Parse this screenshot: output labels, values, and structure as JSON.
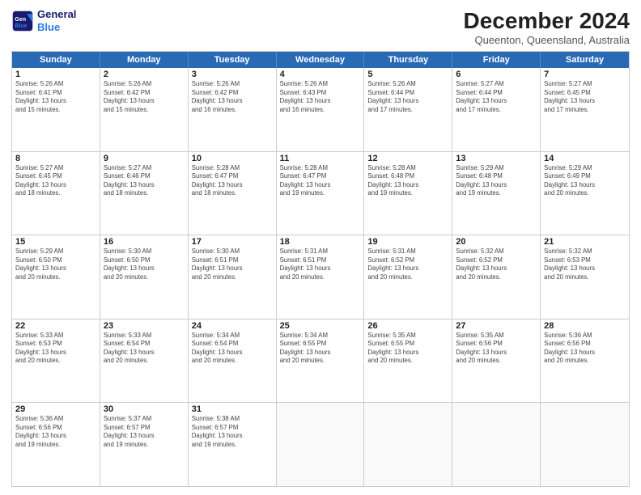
{
  "logo": {
    "line1": "General",
    "line2": "Blue"
  },
  "title": "December 2024",
  "subtitle": "Queenton, Queensland, Australia",
  "days_of_week": [
    "Sunday",
    "Monday",
    "Tuesday",
    "Wednesday",
    "Thursday",
    "Friday",
    "Saturday"
  ],
  "weeks": [
    [
      {
        "day": "1",
        "info": "Sunrise: 5:26 AM\nSunset: 6:41 PM\nDaylight: 13 hours\nand 15 minutes."
      },
      {
        "day": "2",
        "info": "Sunrise: 5:26 AM\nSunset: 6:42 PM\nDaylight: 13 hours\nand 15 minutes."
      },
      {
        "day": "3",
        "info": "Sunrise: 5:26 AM\nSunset: 6:42 PM\nDaylight: 13 hours\nand 16 minutes."
      },
      {
        "day": "4",
        "info": "Sunrise: 5:26 AM\nSunset: 6:43 PM\nDaylight: 13 hours\nand 16 minutes."
      },
      {
        "day": "5",
        "info": "Sunrise: 5:26 AM\nSunset: 6:44 PM\nDaylight: 13 hours\nand 17 minutes."
      },
      {
        "day": "6",
        "info": "Sunrise: 5:27 AM\nSunset: 6:44 PM\nDaylight: 13 hours\nand 17 minutes."
      },
      {
        "day": "7",
        "info": "Sunrise: 5:27 AM\nSunset: 6:45 PM\nDaylight: 13 hours\nand 17 minutes."
      }
    ],
    [
      {
        "day": "8",
        "info": "Sunrise: 5:27 AM\nSunset: 6:45 PM\nDaylight: 13 hours\nand 18 minutes."
      },
      {
        "day": "9",
        "info": "Sunrise: 5:27 AM\nSunset: 6:46 PM\nDaylight: 13 hours\nand 18 minutes."
      },
      {
        "day": "10",
        "info": "Sunrise: 5:28 AM\nSunset: 6:47 PM\nDaylight: 13 hours\nand 18 minutes."
      },
      {
        "day": "11",
        "info": "Sunrise: 5:28 AM\nSunset: 6:47 PM\nDaylight: 13 hours\nand 19 minutes."
      },
      {
        "day": "12",
        "info": "Sunrise: 5:28 AM\nSunset: 6:48 PM\nDaylight: 13 hours\nand 19 minutes."
      },
      {
        "day": "13",
        "info": "Sunrise: 5:29 AM\nSunset: 6:48 PM\nDaylight: 13 hours\nand 19 minutes."
      },
      {
        "day": "14",
        "info": "Sunrise: 5:29 AM\nSunset: 6:49 PM\nDaylight: 13 hours\nand 20 minutes."
      }
    ],
    [
      {
        "day": "15",
        "info": "Sunrise: 5:29 AM\nSunset: 6:50 PM\nDaylight: 13 hours\nand 20 minutes."
      },
      {
        "day": "16",
        "info": "Sunrise: 5:30 AM\nSunset: 6:50 PM\nDaylight: 13 hours\nand 20 minutes."
      },
      {
        "day": "17",
        "info": "Sunrise: 5:30 AM\nSunset: 6:51 PM\nDaylight: 13 hours\nand 20 minutes."
      },
      {
        "day": "18",
        "info": "Sunrise: 5:31 AM\nSunset: 6:51 PM\nDaylight: 13 hours\nand 20 minutes."
      },
      {
        "day": "19",
        "info": "Sunrise: 5:31 AM\nSunset: 6:52 PM\nDaylight: 13 hours\nand 20 minutes."
      },
      {
        "day": "20",
        "info": "Sunrise: 5:32 AM\nSunset: 6:52 PM\nDaylight: 13 hours\nand 20 minutes."
      },
      {
        "day": "21",
        "info": "Sunrise: 5:32 AM\nSunset: 6:53 PM\nDaylight: 13 hours\nand 20 minutes."
      }
    ],
    [
      {
        "day": "22",
        "info": "Sunrise: 5:33 AM\nSunset: 6:53 PM\nDaylight: 13 hours\nand 20 minutes."
      },
      {
        "day": "23",
        "info": "Sunrise: 5:33 AM\nSunset: 6:54 PM\nDaylight: 13 hours\nand 20 minutes."
      },
      {
        "day": "24",
        "info": "Sunrise: 5:34 AM\nSunset: 6:54 PM\nDaylight: 13 hours\nand 20 minutes."
      },
      {
        "day": "25",
        "info": "Sunrise: 5:34 AM\nSunset: 6:55 PM\nDaylight: 13 hours\nand 20 minutes."
      },
      {
        "day": "26",
        "info": "Sunrise: 5:35 AM\nSunset: 6:55 PM\nDaylight: 13 hours\nand 20 minutes."
      },
      {
        "day": "27",
        "info": "Sunrise: 5:35 AM\nSunset: 6:56 PM\nDaylight: 13 hours\nand 20 minutes."
      },
      {
        "day": "28",
        "info": "Sunrise: 5:36 AM\nSunset: 6:56 PM\nDaylight: 13 hours\nand 20 minutes."
      }
    ],
    [
      {
        "day": "29",
        "info": "Sunrise: 5:36 AM\nSunset: 6:56 PM\nDaylight: 13 hours\nand 19 minutes."
      },
      {
        "day": "30",
        "info": "Sunrise: 5:37 AM\nSunset: 6:57 PM\nDaylight: 13 hours\nand 19 minutes."
      },
      {
        "day": "31",
        "info": "Sunrise: 5:38 AM\nSunset: 6:57 PM\nDaylight: 13 hours\nand 19 minutes."
      },
      {
        "day": "",
        "info": ""
      },
      {
        "day": "",
        "info": ""
      },
      {
        "day": "",
        "info": ""
      },
      {
        "day": "",
        "info": ""
      }
    ]
  ]
}
